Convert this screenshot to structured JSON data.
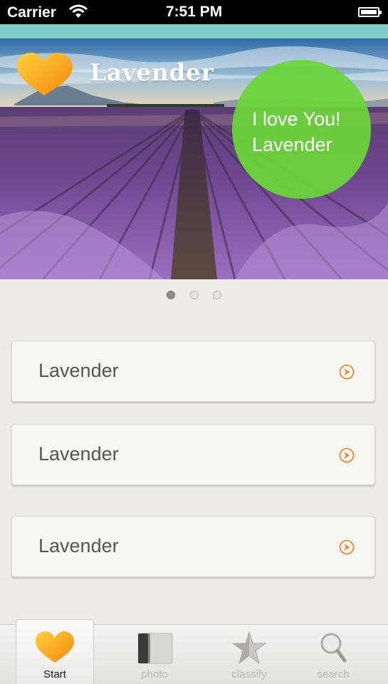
{
  "status_bar": {
    "carrier": "Carrier",
    "time": "7:51 PM"
  },
  "banner": {
    "brand_name": "Lavender",
    "bubble_line1": "I love You!",
    "bubble_line2": "Lavender",
    "page_dots": {
      "count": 3,
      "active_index": 0
    }
  },
  "list": {
    "items": [
      {
        "label": "Lavender",
        "icon": "chevron-right-circle-icon"
      },
      {
        "label": "Lavender",
        "icon": "chevron-right-circle-icon"
      },
      {
        "label": "Lavender",
        "icon": "chevron-right-circle-icon"
      }
    ]
  },
  "tabbar": {
    "tabs": [
      {
        "label": "Start",
        "icon": "heart-icon",
        "active": true
      },
      {
        "label": "photo",
        "icon": "photo-album-icon",
        "active": false
      },
      {
        "label": "classify",
        "icon": "star-icon",
        "active": false
      },
      {
        "label": "search",
        "icon": "search-icon",
        "active": false
      }
    ]
  },
  "colors": {
    "accent_teal": "#7fcbc6",
    "bubble_green": "#6ad638",
    "chevron_orange": "#f07d1a",
    "heart_orange": "#f8a21b"
  }
}
